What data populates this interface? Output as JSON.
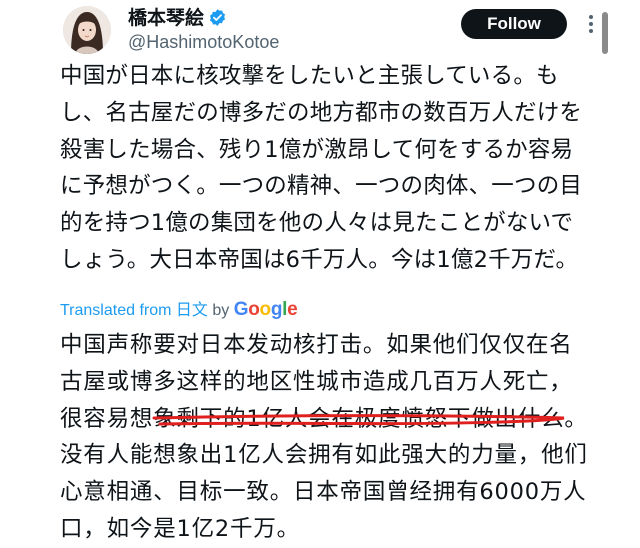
{
  "user": {
    "display_name": "橋本琴絵",
    "handle": "@HashimotoKotoe",
    "avatar_icon": "avatar-photo",
    "verified_icon": "verified-badge-icon",
    "verified_color": "#1d9bf0"
  },
  "follow_button": {
    "label": "Follow"
  },
  "more_icon": "more-options-icon",
  "tweet": {
    "text": "中国が日本に核攻撃をしたいと主張している。もし、名古屋だの博多だの地方都市の数百万人だけを殺害した場合、残り1億が激昂して何をするか容易に予想がつく。一つの精神、一つの肉体、一つの目的を持つ1億の集団を他の人々は見たことがないでしょう。大日本帝国は6千万人。今は1億2千万だ。"
  },
  "translation": {
    "prefix": "Translated from ",
    "language": "日文",
    "by": " by ",
    "provider": "Google",
    "text_before_highlight": "中国声称要对日本发动核打击。如果他们仅仅在名古屋或博多这样的地区性城市造成几百万人死亡，很容易",
    "highlighted": "想象剩下的1亿人会在极度愤怒下做出",
    "text_after_highlight": "什么。没有人能想象出1亿人会拥有如此强大的力量，他们心意相通、目标一致。日本帝国曾经拥有6000万人口，如今是1亿2千万。",
    "highlight_color": "#e0201f"
  },
  "colors": {
    "link": "#1d9bf0",
    "secondary_text": "#536471",
    "primary_text": "#0f1419"
  }
}
